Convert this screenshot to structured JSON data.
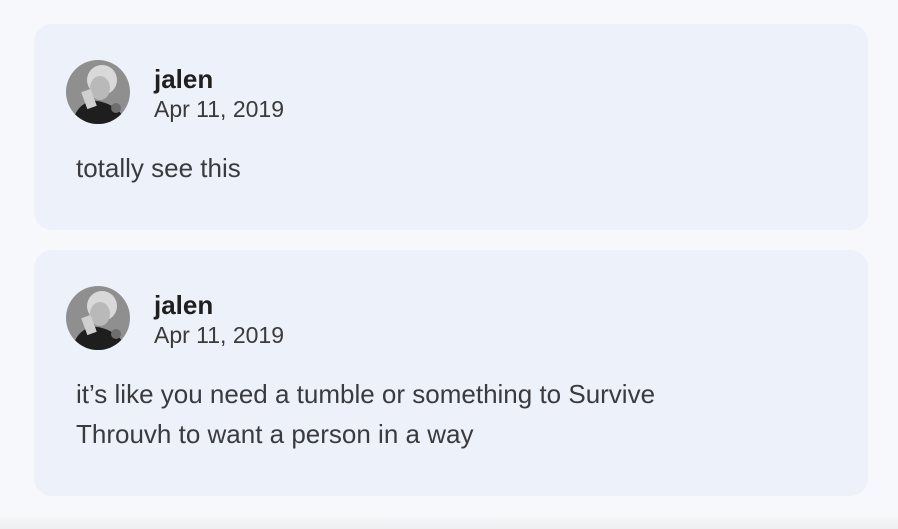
{
  "comments": [
    {
      "author": "jalen",
      "date": "Apr 11, 2019",
      "text": "totally see this"
    },
    {
      "author": "jalen",
      "date": "Apr 11, 2019",
      "text": "it’s like you need a tumble or something to Survive\nThrouvh to want a person in a way"
    }
  ],
  "colors": {
    "page_background": "#f7f8fb",
    "card_background": "#edf1fa",
    "author_text": "#1f1f1f",
    "body_text": "#3a3b3f"
  },
  "icons": {
    "avatar": "user-avatar-photo"
  }
}
